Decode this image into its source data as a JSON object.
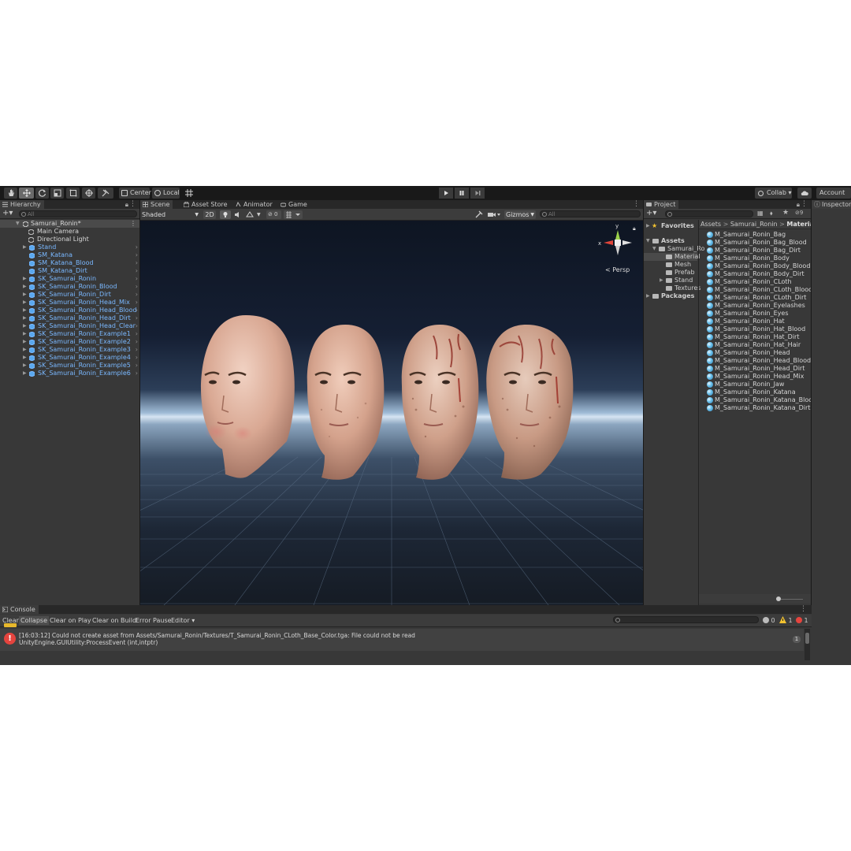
{
  "toolbar": {
    "center_label": "Center",
    "local_label": "Local",
    "collab_label": "Collab ▾",
    "account_label": "Account"
  },
  "hierarchy": {
    "tab": "Hierarchy",
    "search_placeholder": "All",
    "root": "Samurai_Ronin*",
    "items": [
      {
        "label": "Main Camera",
        "color": "white",
        "expandable": false
      },
      {
        "label": "Directional Light",
        "color": "white",
        "expandable": false
      },
      {
        "label": "Stand",
        "color": "blue",
        "expandable": true
      },
      {
        "label": "SM_Katana",
        "color": "blue",
        "expandable": false
      },
      {
        "label": "SM_Katana_Blood",
        "color": "blue",
        "expandable": false
      },
      {
        "label": "SM_Katana_Dirt",
        "color": "blue",
        "expandable": false
      },
      {
        "label": "SK_Samurai_Ronin",
        "color": "blue",
        "expandable": true
      },
      {
        "label": "SK_Samurai_Ronin_Blood",
        "color": "blue",
        "expandable": true
      },
      {
        "label": "SK_Samurai_Ronin_Dirt",
        "color": "blue",
        "expandable": true
      },
      {
        "label": "SK_Samurai_Ronin_Head_Mix",
        "color": "blue",
        "expandable": true
      },
      {
        "label": "SK_Samurai_Ronin_Head_Blood",
        "color": "blue",
        "expandable": true
      },
      {
        "label": "SK_Samurai_Ronin_Head_Dirt",
        "color": "blue",
        "expandable": true
      },
      {
        "label": "SK_Samurai_Ronin_Head_Clear",
        "color": "blue",
        "expandable": true
      },
      {
        "label": "SK_Samurai_Ronin_Example1",
        "color": "blue",
        "expandable": true
      },
      {
        "label": "SK_Samurai_Ronin_Example2",
        "color": "blue",
        "expandable": true
      },
      {
        "label": "SK_Samurai_Ronin_Example3",
        "color": "blue",
        "expandable": true
      },
      {
        "label": "SK_Samurai_Ronin_Example4",
        "color": "blue",
        "expandable": true
      },
      {
        "label": "SK_Samurai_Ronin_Example5",
        "color": "blue",
        "expandable": true
      },
      {
        "label": "SK_Samurai_Ronin_Example6",
        "color": "blue",
        "expandable": true
      }
    ]
  },
  "scene": {
    "tabs": [
      "Scene",
      "Asset Store",
      "Animator",
      "Game"
    ],
    "shading": "Shaded",
    "mode_2d": "2D",
    "visibility_count": "0",
    "gizmos": "Gizmos",
    "search_placeholder": "All",
    "persp_label": "< Persp",
    "axis_x": "x",
    "axis_y": "y"
  },
  "project": {
    "tab": "Project",
    "hidden_count": "9",
    "favorites": "Favorites",
    "assets": "Assets",
    "folders": [
      "Samurai_Ro",
      "Material",
      "Mesh",
      "Prefab",
      "Stand",
      "Textures"
    ],
    "packages": "Packages",
    "breadcrumb": [
      "Assets",
      "Samurai_Ronin",
      "Materials"
    ],
    "materials": [
      "M_Samurai_Ronin_Bag",
      "M_Samurai_Ronin_Bag_Blood",
      "M_Samurai_Ronin_Bag_Dirt",
      "M_Samurai_Ronin_Body",
      "M_Samurai_Ronin_Body_Blood",
      "M_Samurai_Ronin_Body_Dirt",
      "M_Samurai_Ronin_CLoth",
      "M_Samurai_Ronin_CLoth_Blood",
      "M_Samurai_Ronin_CLoth_Dirt",
      "M_Samurai_Ronin_Eyelashes",
      "M_Samurai_Ronin_Eyes",
      "M_Samurai_Ronin_Hat",
      "M_Samurai_Ronin_Hat_Blood",
      "M_Samurai_Ronin_Hat_Dirt",
      "M_Samurai_Ronin_Hat_Hair",
      "M_Samurai_Ronin_Head",
      "M_Samurai_Ronin_Head_Blood",
      "M_Samurai_Ronin_Head_Dirt",
      "M_Samurai_Ronin_Head_Mix",
      "M_Samurai_Ronin_Jaw",
      "M_Samurai_Ronin_Katana",
      "M_Samurai_Ronin_Katana_Blood",
      "M_Samurai_Ronin_Katana_Dirt"
    ]
  },
  "inspector": {
    "tab": "Inspector"
  },
  "console": {
    "tab": "Console",
    "buttons": [
      "Clear",
      "Collapse",
      "Clear on Play",
      "Clear on Build",
      "Error Pause",
      "Editor ▾"
    ],
    "log_count": "0",
    "warn_count": "1",
    "error_count": "1",
    "error_line1": "[16:03:12] Could not create asset from Assets/Samurai_Ronin/Textures/T_Samurai_Ronin_CLoth_Base_Color.tga: File could not be read",
    "error_line2": "UnityEngine.GUIUtility:ProcessEvent (int,intptr)",
    "error_repeat": "1"
  },
  "colors": {
    "accent_blue": "#7ab8ff",
    "error_red": "#e5443e",
    "warning_yellow": "#f2c230"
  }
}
